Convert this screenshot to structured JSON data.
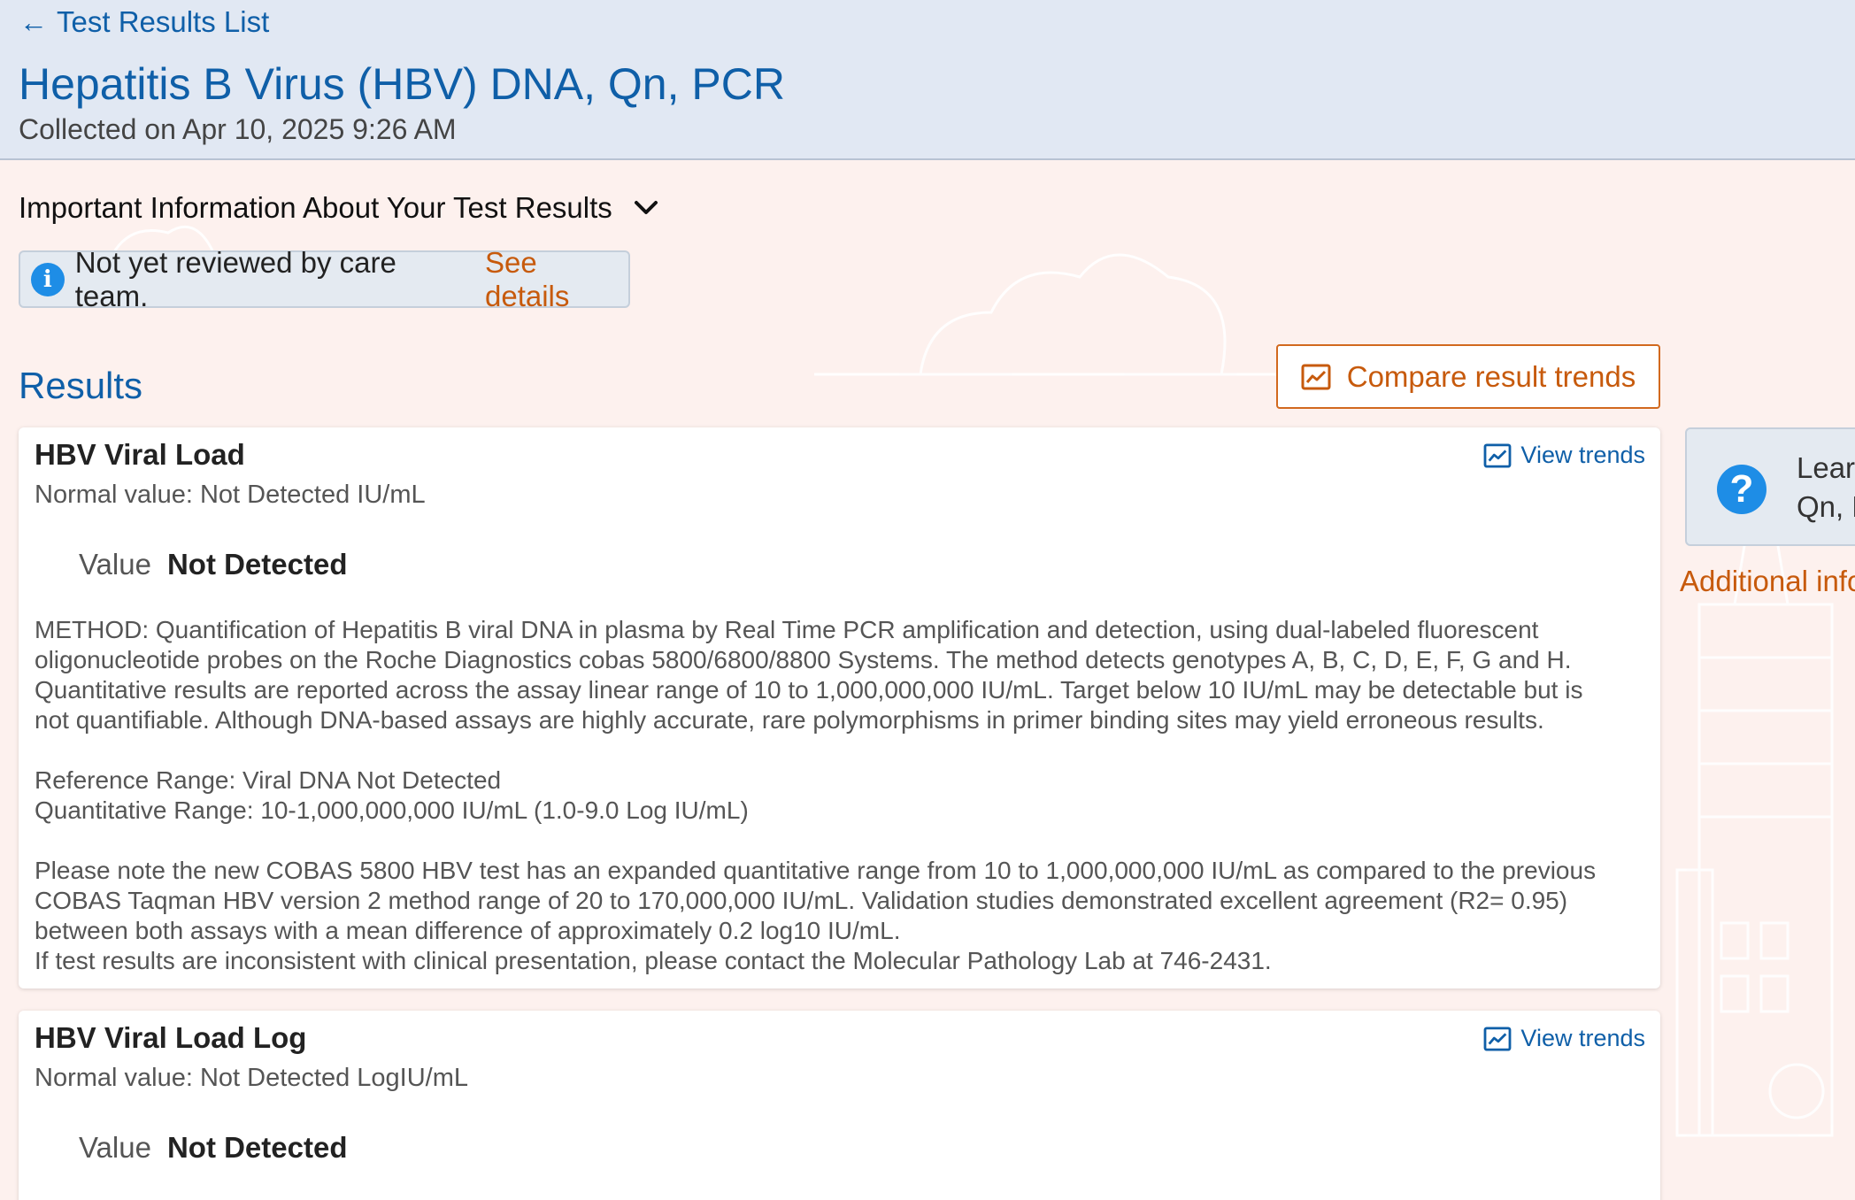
{
  "nav": {
    "back_label": "Test Results List"
  },
  "header": {
    "title": "Hepatitis B Virus (HBV) DNA, Qn, PCR",
    "collected": "Collected on Apr 10, 2025 9:26 AM"
  },
  "important": {
    "label": "Important Information About Your Test Results"
  },
  "review": {
    "text": "Not yet reviewed by care team.",
    "link": "See details"
  },
  "results": {
    "heading": "Results",
    "compare_label": "Compare result trends",
    "cards": [
      {
        "name": "HBV Viral Load",
        "normal": "Normal value: Not Detected IU/mL",
        "view_trends": "View trends",
        "value_label": "Value",
        "value": "Not Detected",
        "comment": {
          "p1": [
            "METHOD: Quantification of Hepatitis B viral DNA in plasma by Real Time PCR amplification and detection, using dual-labeled fluorescent",
            "oligonucleotide probes on the Roche Diagnostics cobas 5800/6800/8800 Systems. The method detects genotypes A, B, C, D, E, F, G and H.",
            "Quantitative results are reported across the assay linear range of 10 to 1,000,000,000 IU/mL. Target below 10 IU/mL may be detectable but is",
            "not quantifiable. Although DNA-based assays are highly accurate, rare polymorphisms in primer binding sites may yield erroneous results."
          ],
          "p2": [
            "Reference Range: Viral DNA Not Detected",
            "Quantitative Range: 10-1,000,000,000 IU/mL (1.0-9.0 Log IU/mL)"
          ],
          "p3": [
            "Please note the new COBAS 5800 HBV test has an expanded quantitative range from 10 to 1,000,000,000 IU/mL as compared to the previous",
            "COBAS Taqman HBV version 2 method range of 20 to 170,000,000 IU/mL. Validation studies demonstrated excellent agreement (R2= 0.95)",
            "between both assays with a mean difference of approximately 0.2 log10 IU/mL.",
            "If test results are inconsistent with clinical presentation, please contact the Molecular Pathology Lab at 746-2431."
          ]
        }
      },
      {
        "name": "HBV Viral Load Log",
        "normal": "Normal value: Not Detected LogIU/mL",
        "view_trends": "View trends",
        "value_label": "Value",
        "value": "Not Detected"
      }
    ]
  },
  "side": {
    "learn_line1": "Lear",
    "learn_line2": "Qn, P",
    "additional": "Additional info"
  },
  "colors": {
    "accent_blue": "#0f5fa8",
    "accent_orange": "#c75a0c",
    "info_blue": "#1e8de6",
    "header_bg": "#e1e8f3",
    "page_bg": "#fdf1ee"
  }
}
